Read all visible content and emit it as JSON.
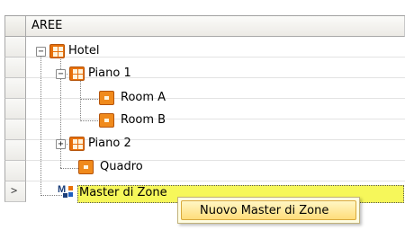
{
  "header": {
    "column_title": "AREE"
  },
  "rows": {
    "current_row_marker": ">"
  },
  "tree": {
    "nodes": [
      {
        "label": "Hotel",
        "expander": "−",
        "icon": "grid-icon"
      },
      {
        "label": "Piano 1",
        "expander": "−",
        "icon": "grid-icon"
      },
      {
        "label": "Room A",
        "icon": "room-icon"
      },
      {
        "label": "Room B",
        "icon": "room-icon"
      },
      {
        "label": "Piano 2",
        "expander": "+",
        "icon": "grid-icon"
      },
      {
        "label": "Quadro",
        "icon": "room-icon"
      },
      {
        "label": "Master di Zone",
        "icon": "master-icon",
        "selected": true
      }
    ]
  },
  "context_menu": {
    "items": [
      {
        "label": "Nuovo Master di Zone"
      }
    ]
  },
  "colors": {
    "selection": "#f6f75a",
    "icon_orange": "#e8710a",
    "menu_highlight": "#ffdd7a"
  }
}
